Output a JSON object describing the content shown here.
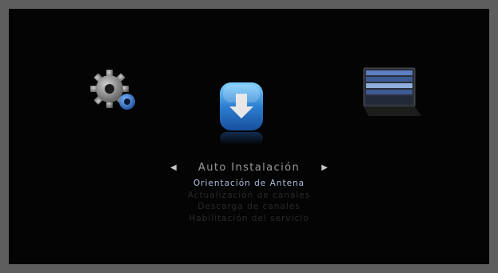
{
  "menu": {
    "prev_arrow": "◀",
    "next_arrow": "▶",
    "title": "Auto Instalación",
    "items": [
      "Orientación de Antena",
      "Actualización de canales",
      "Descarga de canales",
      "Habilitación del servicio"
    ],
    "active_index": 0
  },
  "icons": {
    "left": "settings-gear-icon",
    "center": "download-arrow-icon",
    "right": "tv-guide-screen-icon"
  },
  "colors": {
    "background": "#040404",
    "frame": "#5e5e5e",
    "active_item": "#aebfe0",
    "title": "#9a9a9a",
    "inactive_item": "#2a2a2a",
    "accent_blue": "#2d7fd0"
  }
}
